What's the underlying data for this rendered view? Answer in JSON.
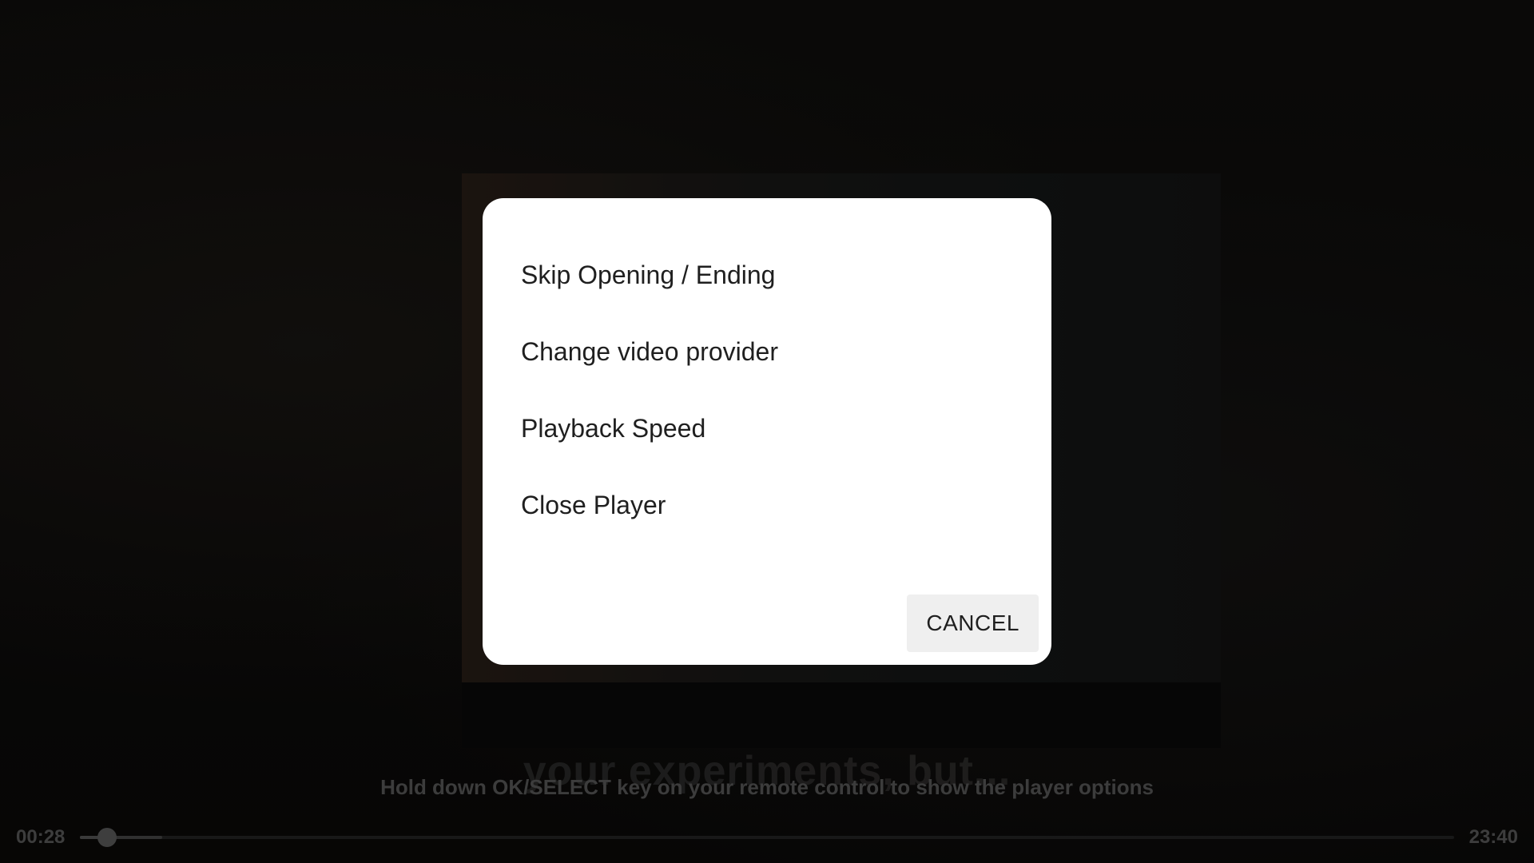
{
  "player": {
    "subtitle_text": "your experiments, but...",
    "hint": "Hold down OK/SELECT key on your remote control to show the player options",
    "current_time": "00:28",
    "total_time": "23:40",
    "progress_fraction": 0.0197,
    "buffered_fraction": 0.06
  },
  "dialog": {
    "items": [
      {
        "label": "Skip Opening / Ending"
      },
      {
        "label": "Change video provider"
      },
      {
        "label": "Playback Speed"
      },
      {
        "label": "Close Player"
      }
    ],
    "cancel_label": "CANCEL"
  }
}
